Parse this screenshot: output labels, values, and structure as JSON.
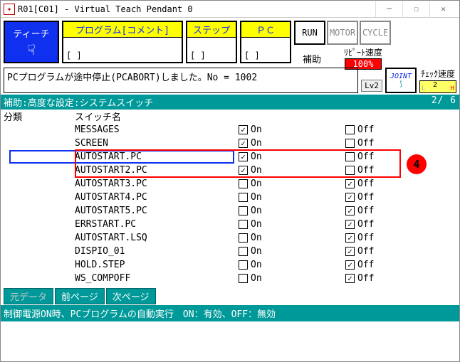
{
  "window": {
    "title": "R01[C01] - Virtual Teach Pendant 0"
  },
  "toolbar": {
    "teach": "ティーチ",
    "program_label": "プログラム[コメント]",
    "program_value": "[                     ]",
    "step_label": "ステップ",
    "step_value": "[     ]",
    "pc_label": "ＰＣ",
    "pc_value": "[     ]",
    "run": "RUN",
    "motor": "MOTOR",
    "cycle": "CYCLE",
    "aux": "補助",
    "repeat_speed_label": "ﾘﾋﾟｰﾄ速度",
    "repeat_speed_value": "100%",
    "check_speed_label": "ﾁｪｯｸ速度",
    "check_lo": "L",
    "check_hi": "H",
    "check_val": "2"
  },
  "message": {
    "text": "PCプログラムが途中停止(PCABORT)しました。No = 1002",
    "lv": "Lv2",
    "joint": "JOINT"
  },
  "table": {
    "title": "補助:高度な設定:システムスイッチ",
    "page": "2/ 6",
    "col1": "分類",
    "col2": "スイッチ名",
    "on_label": "On",
    "off_label": "Off",
    "rows": [
      {
        "name": "MESSAGES",
        "on": true,
        "off": false
      },
      {
        "name": "SCREEN",
        "on": true,
        "off": false
      },
      {
        "name": "AUTOSTART.PC",
        "on": true,
        "off": false
      },
      {
        "name": "AUTOSTART2.PC",
        "on": true,
        "off": false
      },
      {
        "name": "AUTOSTART3.PC",
        "on": false,
        "off": true
      },
      {
        "name": "AUTOSTART4.PC",
        "on": false,
        "off": true
      },
      {
        "name": "AUTOSTART5.PC",
        "on": false,
        "off": true
      },
      {
        "name": "ERRSTART.PC",
        "on": false,
        "off": true
      },
      {
        "name": "AUTOSTART.LSQ",
        "on": false,
        "off": true
      },
      {
        "name": "DISPIO_01",
        "on": false,
        "off": true
      },
      {
        "name": "HOLD.STEP",
        "on": false,
        "off": true
      },
      {
        "name": "WS_COMPOFF",
        "on": false,
        "off": true
      }
    ]
  },
  "footer": {
    "btn1": "元データ",
    "btn2": "前ページ",
    "btn3": "次ページ",
    "status": "制御電源ON時、PCプログラムの自動実行　ON：有効、OFF：無効"
  },
  "annotation": {
    "num": "4"
  }
}
